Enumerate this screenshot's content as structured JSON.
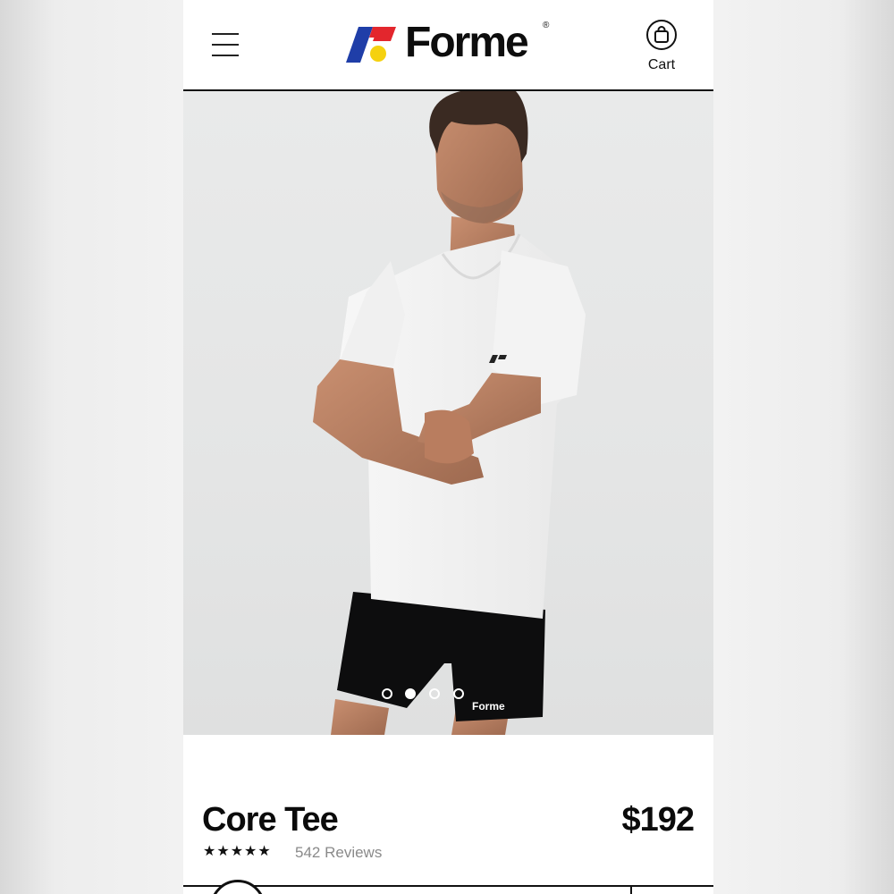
{
  "header": {
    "menu_icon": "hamburger-menu-icon",
    "brand": "Forme",
    "brand_mark": "®",
    "cart_label": "Cart",
    "cart_icon": "shopping-bag-icon",
    "logo_colors": {
      "blue": "#1f3ea8",
      "red": "#e3262d",
      "yellow": "#f5d10f"
    }
  },
  "hero": {
    "image_alt": "Man wearing white tee and black shorts",
    "carousel_total": 4,
    "carousel_active": 2,
    "sleeve_logo": "Forme"
  },
  "product": {
    "title": "Core Tee",
    "price": "$192",
    "stars": "★★★★★",
    "rating": 5,
    "reviews": "542 Reviews"
  }
}
